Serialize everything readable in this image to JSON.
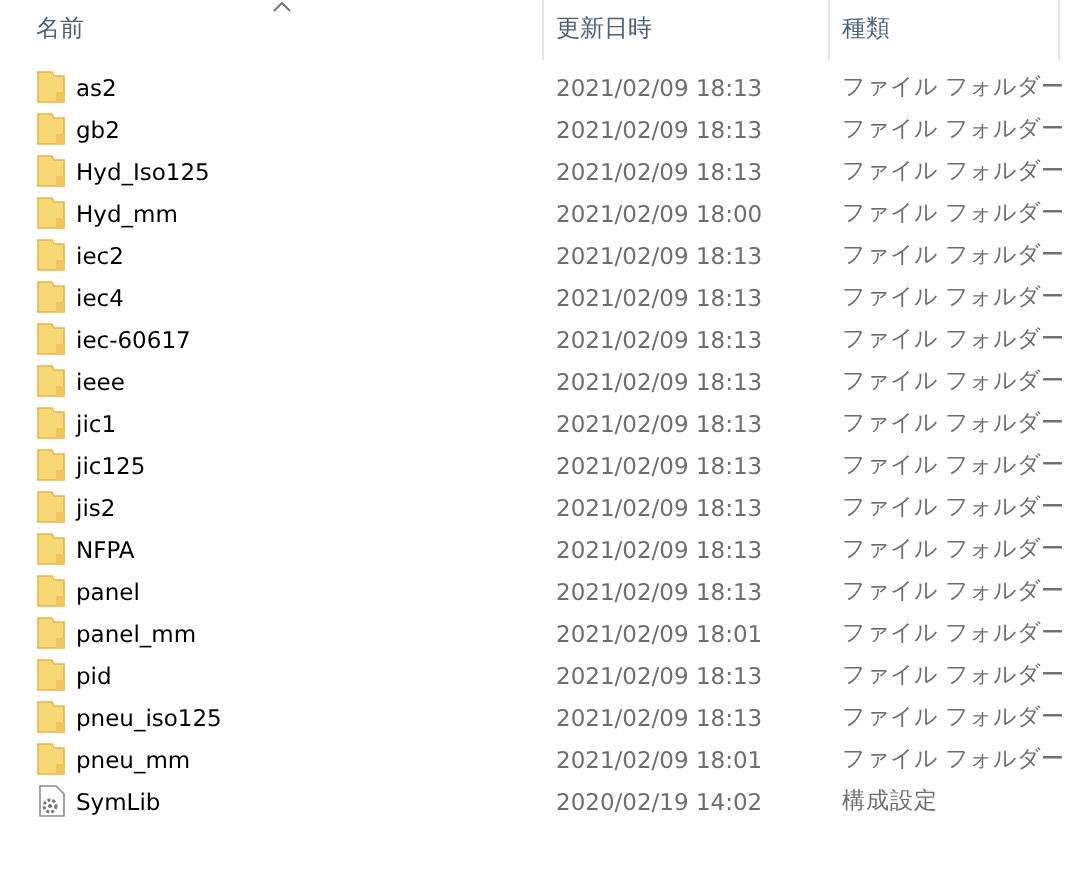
{
  "columns": [
    {
      "label": "名前",
      "sorted": true
    },
    {
      "label": "更新日時",
      "sorted": false
    },
    {
      "label": "種類",
      "sorted": false
    }
  ],
  "rows": [
    {
      "kind": "folder",
      "name": "as2",
      "date": "2021/02/09 18:13",
      "type": "ファイル フォルダー"
    },
    {
      "kind": "folder",
      "name": "gb2",
      "date": "2021/02/09 18:13",
      "type": "ファイル フォルダー"
    },
    {
      "kind": "folder",
      "name": "Hyd_Iso125",
      "date": "2021/02/09 18:13",
      "type": "ファイル フォルダー"
    },
    {
      "kind": "folder",
      "name": "Hyd_mm",
      "date": "2021/02/09 18:00",
      "type": "ファイル フォルダー"
    },
    {
      "kind": "folder",
      "name": "iec2",
      "date": "2021/02/09 18:13",
      "type": "ファイル フォルダー"
    },
    {
      "kind": "folder",
      "name": "iec4",
      "date": "2021/02/09 18:13",
      "type": "ファイル フォルダー"
    },
    {
      "kind": "folder",
      "name": "iec-60617",
      "date": "2021/02/09 18:13",
      "type": "ファイル フォルダー"
    },
    {
      "kind": "folder",
      "name": "ieee",
      "date": "2021/02/09 18:13",
      "type": "ファイル フォルダー"
    },
    {
      "kind": "folder",
      "name": "jic1",
      "date": "2021/02/09 18:13",
      "type": "ファイル フォルダー"
    },
    {
      "kind": "folder",
      "name": "jic125",
      "date": "2021/02/09 18:13",
      "type": "ファイル フォルダー"
    },
    {
      "kind": "folder",
      "name": "jis2",
      "date": "2021/02/09 18:13",
      "type": "ファイル フォルダー"
    },
    {
      "kind": "folder",
      "name": "NFPA",
      "date": "2021/02/09 18:13",
      "type": "ファイル フォルダー"
    },
    {
      "kind": "folder",
      "name": "panel",
      "date": "2021/02/09 18:13",
      "type": "ファイル フォルダー"
    },
    {
      "kind": "folder",
      "name": "panel_mm",
      "date": "2021/02/09 18:01",
      "type": "ファイル フォルダー"
    },
    {
      "kind": "folder",
      "name": "pid",
      "date": "2021/02/09 18:13",
      "type": "ファイル フォルダー"
    },
    {
      "kind": "folder",
      "name": "pneu_iso125",
      "date": "2021/02/09 18:13",
      "type": "ファイル フォルダー"
    },
    {
      "kind": "folder",
      "name": "pneu_mm",
      "date": "2021/02/09 18:01",
      "type": "ファイル フォルダー"
    },
    {
      "kind": "config",
      "name": "SymLib",
      "date": "2020/02/19 14:02",
      "type": "構成設定"
    }
  ]
}
